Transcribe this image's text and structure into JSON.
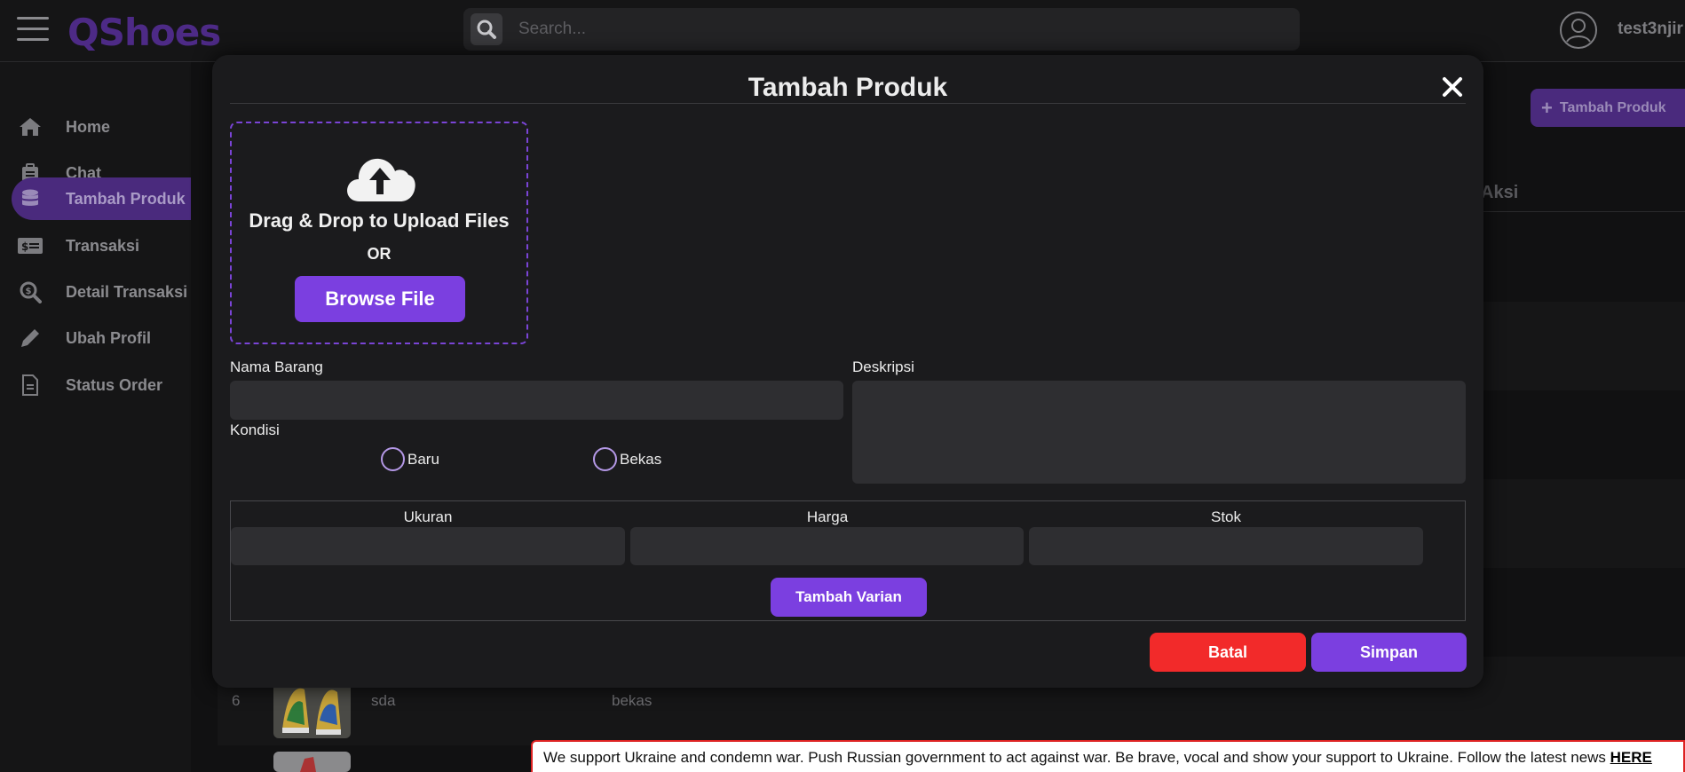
{
  "app": {
    "logo": "QShoes",
    "username": "test3njir"
  },
  "search": {
    "placeholder": "Search..."
  },
  "sidebar": {
    "items": [
      {
        "label": "Home",
        "icon": "home-icon"
      },
      {
        "label": "Chat",
        "icon": "chat-icon"
      },
      {
        "label": "Tambah Produk",
        "icon": "database-icon",
        "active": true
      },
      {
        "label": "Transaksi",
        "icon": "money-bill-icon"
      },
      {
        "label": "Detail Transaksi",
        "icon": "search-dollar-icon"
      },
      {
        "label": "Ubah Profil",
        "icon": "pencil-icon"
      },
      {
        "label": "Status Order",
        "icon": "document-icon"
      }
    ]
  },
  "background": {
    "add_button": "Tambah Produk",
    "column_aksi": "Aksi",
    "row": {
      "number": "6",
      "name": "sda",
      "condition": "bekas"
    }
  },
  "modal": {
    "title": "Tambah Produk",
    "dropzone": {
      "text": "Drag & Drop to Upload Files",
      "or": "OR",
      "browse_label": "Browse File"
    },
    "nama_barang_label": "Nama Barang",
    "nama_barang_value": "",
    "deskripsi_label": "Deskripsi",
    "deskripsi_value": "",
    "kondisi_label": "Kondisi",
    "kondisi_options": [
      "Baru",
      "Bekas"
    ],
    "variant": {
      "ukuran_label": "Ukuran",
      "harga_label": "Harga",
      "stok_label": "Stok",
      "add_label": "Tambah Varian"
    },
    "batal_label": "Batal",
    "simpan_label": "Simpan"
  },
  "banner": {
    "text": "We support Ukraine and condemn war. Push Russian government to act against war. Be brave, vocal and show your support to Ukraine. Follow the latest news ",
    "link": "HERE"
  },
  "colors": {
    "accent": "#7b3fe0",
    "danger": "#f22a2a",
    "logo": "#4d2a86"
  }
}
